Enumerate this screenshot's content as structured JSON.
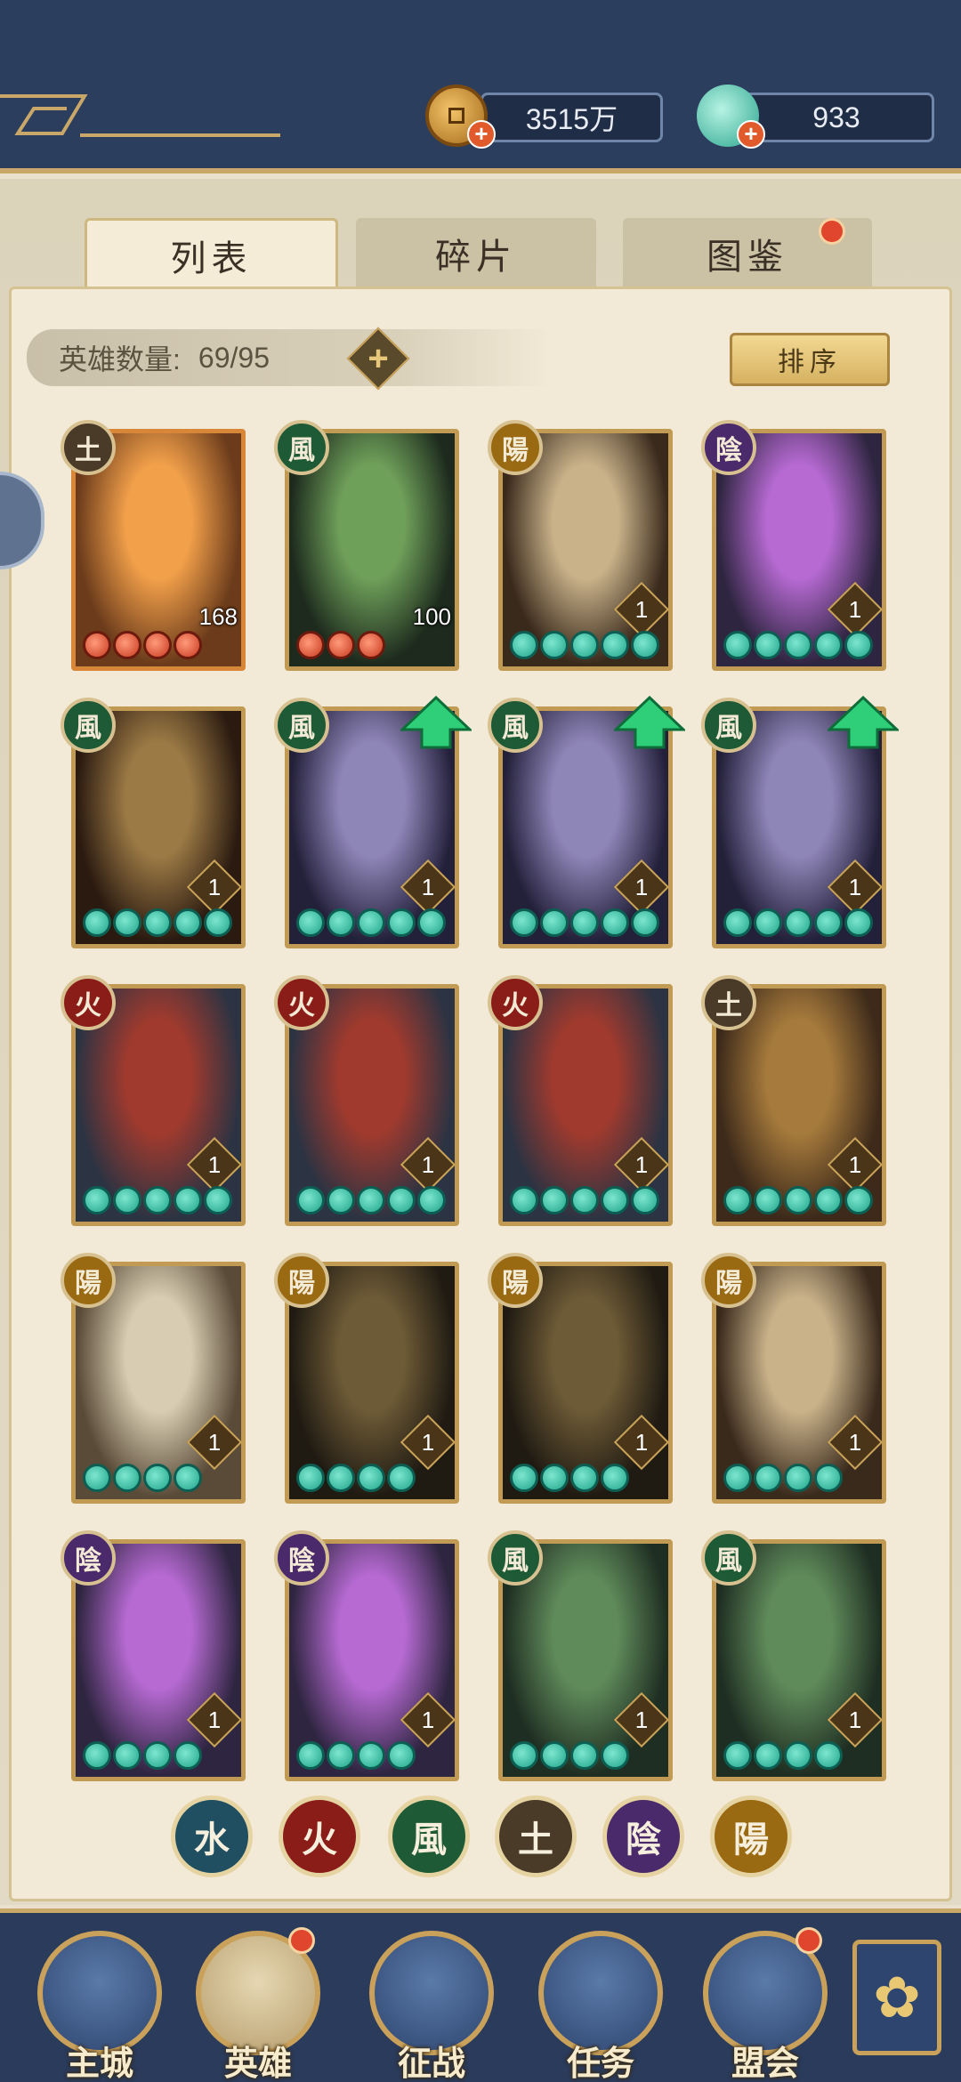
{
  "resources": {
    "coins": "3515万",
    "jade": "933",
    "coin_icon": "coin-icon",
    "jade_icon": "jade-shell-icon"
  },
  "tabs": [
    {
      "label": "列表",
      "active": true
    },
    {
      "label": "碎片",
      "active": false
    },
    {
      "label": "图鉴",
      "active": false,
      "badge": true
    }
  ],
  "hero_count_label": "英雄数量:",
  "hero_count": "69/95",
  "sort_label": "排序",
  "elements": {
    "water": {
      "glyph": "水",
      "color": "#1f4f61"
    },
    "fire": {
      "glyph": "火",
      "color": "#8b1d18"
    },
    "wind": {
      "glyph": "風",
      "color": "#1f5a36"
    },
    "earth": {
      "glyph": "土",
      "color": "#4a3a28"
    },
    "yin": {
      "glyph": "陰",
      "color": "#4a2a6b"
    },
    "yang": {
      "glyph": "陽",
      "color": "#9a6a12"
    }
  },
  "heroes": [
    {
      "element": "土",
      "level": "168",
      "stars": 4,
      "star_color": "red",
      "frame": "orange",
      "palette": [
        "#f2a04a",
        "#6b3b1b"
      ]
    },
    {
      "element": "風",
      "level": "100",
      "stars": 3,
      "star_color": "red",
      "frame": "gold",
      "palette": [
        "#6fa05a",
        "#1d2a1d"
      ]
    },
    {
      "element": "陽",
      "level": "1",
      "stars": 5,
      "star_color": "teal",
      "frame": "gold",
      "palette": [
        "#c9b28a",
        "#3a2a1c"
      ]
    },
    {
      "element": "陰",
      "level": "1",
      "stars": 5,
      "star_color": "teal",
      "frame": "gold",
      "palette": [
        "#b66ad2",
        "#2e2540"
      ]
    },
    {
      "element": "風",
      "level": "1",
      "stars": 5,
      "star_color": "teal",
      "frame": "gold",
      "palette": [
        "#9c7a45",
        "#2a1a10"
      ]
    },
    {
      "element": "風",
      "level": "1",
      "stars": 5,
      "star_color": "teal",
      "frame": "gold",
      "arrow": true,
      "palette": [
        "#8f86b8",
        "#23203a"
      ]
    },
    {
      "element": "風",
      "level": "1",
      "stars": 5,
      "star_color": "teal",
      "frame": "gold",
      "arrow": true,
      "palette": [
        "#8f86b8",
        "#23203a"
      ]
    },
    {
      "element": "風",
      "level": "1",
      "stars": 5,
      "star_color": "teal",
      "frame": "gold",
      "arrow": true,
      "palette": [
        "#8f86b8",
        "#23203a"
      ]
    },
    {
      "element": "火",
      "level": "1",
      "stars": 5,
      "star_color": "teal",
      "frame": "gold",
      "palette": [
        "#a03a2e",
        "#2c3342"
      ]
    },
    {
      "element": "火",
      "level": "1",
      "stars": 5,
      "star_color": "teal",
      "frame": "gold",
      "palette": [
        "#a03a2e",
        "#2c3342"
      ]
    },
    {
      "element": "火",
      "level": "1",
      "stars": 5,
      "star_color": "teal",
      "frame": "gold",
      "palette": [
        "#a03a2e",
        "#2c3342"
      ]
    },
    {
      "element": "土",
      "level": "1",
      "stars": 5,
      "star_color": "teal",
      "frame": "gold",
      "palette": [
        "#a67a3c",
        "#3d2a1a"
      ]
    },
    {
      "element": "陽",
      "level": "1",
      "stars": 4,
      "star_color": "teal",
      "frame": "gold",
      "palette": [
        "#d8cdb2",
        "#5a4b38"
      ]
    },
    {
      "element": "陽",
      "level": "1",
      "stars": 4,
      "star_color": "teal",
      "frame": "gold",
      "palette": [
        "#6d5a36",
        "#1f1a12"
      ]
    },
    {
      "element": "陽",
      "level": "1",
      "stars": 4,
      "star_color": "teal",
      "frame": "gold",
      "palette": [
        "#6d5a36",
        "#1f1a12"
      ]
    },
    {
      "element": "陽",
      "level": "1",
      "stars": 4,
      "star_color": "teal",
      "frame": "gold",
      "palette": [
        "#c9b28a",
        "#3a2a1c"
      ]
    },
    {
      "element": "陰",
      "level": "1",
      "stars": 4,
      "star_color": "teal",
      "frame": "gold",
      "palette": [
        "#b66ad2",
        "#2e2540"
      ]
    },
    {
      "element": "陰",
      "level": "1",
      "stars": 4,
      "star_color": "teal",
      "frame": "gold",
      "palette": [
        "#b66ad2",
        "#2e2540"
      ]
    },
    {
      "element": "風",
      "level": "1",
      "stars": 4,
      "star_color": "teal",
      "frame": "gold",
      "palette": [
        "#5f8a5a",
        "#1f2e22"
      ]
    },
    {
      "element": "風",
      "level": "1",
      "stars": 4,
      "star_color": "teal",
      "frame": "gold",
      "palette": [
        "#5f8a5a",
        "#1f2e22"
      ]
    }
  ],
  "filters": [
    "水",
    "火",
    "風",
    "土",
    "陰",
    "陽"
  ],
  "nav": [
    {
      "label": "主城",
      "icon": "city-gate-icon",
      "badge": false,
      "active": false
    },
    {
      "label": "英雄",
      "icon": "hero-portrait-icon",
      "badge": true,
      "active": true
    },
    {
      "label": "征战",
      "icon": "battle-icon",
      "badge": false,
      "active": false
    },
    {
      "label": "任务",
      "icon": "task-scroll-icon",
      "badge": false,
      "active": false
    },
    {
      "label": "盟会",
      "icon": "alliance-pavilion-icon",
      "badge": true,
      "active": false
    }
  ],
  "more_icon": "flower-menu-icon"
}
